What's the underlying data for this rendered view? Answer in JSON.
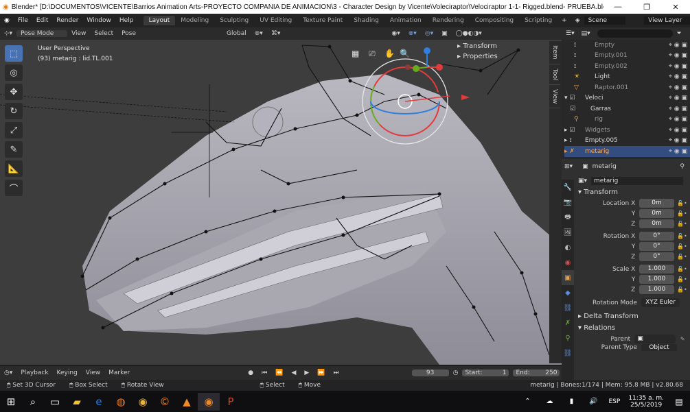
{
  "window": {
    "title": "Blender* [D:\\DOCUMENTOS\\VICENTE\\Barrios Animation Arts-PROYECTO COMPAÑIA DE ANIMACION\\3 - Character Design by Vicente\\Voleciraptor\\Velociraptor 1-1- Rigged.blend- PRUEBA.blend]",
    "minimize": "—",
    "maximize": "❐",
    "close": "✕"
  },
  "menu": {
    "items": [
      "File",
      "Edit",
      "Render",
      "Window",
      "Help"
    ],
    "workspaces": [
      "Layout",
      "Modeling",
      "Sculpting",
      "UV Editing",
      "Texture Paint",
      "Shading",
      "Animation",
      "Rendering",
      "Compositing",
      "Scripting"
    ],
    "scene": "Scene",
    "view_layer": "View Layer"
  },
  "viewport_header": {
    "mode": "Pose Mode",
    "view": "View",
    "select": "Select",
    "pose": "Pose",
    "orientation": "Global"
  },
  "viewport": {
    "perspective": "User Perspective",
    "object_info": "(93) metarig : lid.TL.001",
    "npanel_transform": "Transform",
    "npanel_properties": "Properties",
    "side_tabs": [
      "Item",
      "Tool",
      "View"
    ]
  },
  "outliner": {
    "rows": [
      {
        "name": "Empty",
        "selected": false
      },
      {
        "name": "Empty.001",
        "selected": false
      },
      {
        "name": "Empty.002",
        "selected": false
      },
      {
        "name": "Light",
        "selected": false
      },
      {
        "name": "Raptor.001",
        "selected": false
      },
      {
        "name": "Veloci",
        "selected": false
      },
      {
        "name": "Garras",
        "selected": false
      },
      {
        "name": "rig",
        "selected": false
      },
      {
        "name": "Widgets",
        "selected": false
      },
      {
        "name": "Empty.005",
        "selected": false
      },
      {
        "name": "metarig",
        "selected": true
      }
    ]
  },
  "properties": {
    "object_name": "metarig",
    "data_name": "metarig",
    "transform_header": "Transform",
    "location": {
      "label": "Location X",
      "x": "0m",
      "y": "0m",
      "z": "0m"
    },
    "rotation": {
      "label": "Rotation X",
      "x": "0°",
      "y": "0°",
      "z": "0°"
    },
    "scale": {
      "label": "Scale X",
      "x": "1.000",
      "y": "1.000",
      "z": "1.000"
    },
    "axis_y": "Y",
    "axis_z": "Z",
    "rotation_mode_label": "Rotation Mode",
    "rotation_mode": "XYZ Euler",
    "delta_transform": "Delta Transform",
    "relations": "Relations",
    "parent_label": "Parent",
    "parent_type_label": "Parent Type",
    "parent_type": "Object"
  },
  "timeline": {
    "playback": "Playback",
    "keying": "Keying",
    "view": "View",
    "marker": "Marker",
    "current_frame": "93",
    "start_label": "Start:",
    "start": "1",
    "end_label": "End:",
    "end": "250"
  },
  "statusbar": {
    "left1": "Set 3D Cursor",
    "left2": "Box Select",
    "left3": "Rotate View",
    "mid1": "Select",
    "mid2": "Move",
    "stats": "metarig | Bones:1/174 | Mem: 95.8 MB | v2.80.68"
  },
  "taskbar": {
    "lang": "ESP",
    "time": "11:35 a. m.",
    "date": "25/5/2019"
  }
}
